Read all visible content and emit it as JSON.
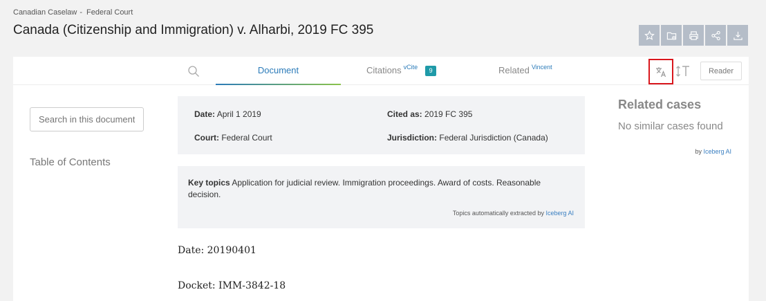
{
  "breadcrumb": {
    "root": "Canadian Caselaw",
    "separator": "-",
    "current": "Federal Court"
  },
  "title": "Canada (Citizenship and Immigration) v. Alharbi, 2019 FC 395",
  "actions": [
    "star-icon",
    "folder-add-icon",
    "print-icon",
    "share-icon",
    "download-icon"
  ],
  "tabs": {
    "document": "Document",
    "citations": "Citations",
    "citations_sup": "vCite",
    "citations_count": "9",
    "related": "Related",
    "related_sup": "Vincent"
  },
  "reader_label": "Reader",
  "search": {
    "placeholder": "Search in this document"
  },
  "toc_label": "Table of Contents",
  "meta": {
    "date_label": "Date:",
    "date": "April 1 2019",
    "cited_label": "Cited as:",
    "cited": "2019 FC 395",
    "court_label": "Court:",
    "court": "Federal Court",
    "jurisdiction_label": "Jurisdiction:",
    "jurisdiction": "Federal Jurisdiction (Canada)"
  },
  "topics": {
    "label": "Key topics",
    "text": "Application for judicial review. Immigration proceedings. Award of costs. Reasonable decision.",
    "note": "Topics automatically extracted by",
    "note_link": "Iceberg AI"
  },
  "document_lines": [
    "Date: 20190401",
    "Docket: IMM-3842-18"
  ],
  "related": {
    "title": "Related cases",
    "empty": "No similar cases found",
    "by": "by",
    "by_link": "Iceberg AI"
  },
  "colors": {
    "accent": "#2b7bb9",
    "badge": "#1f9aa8",
    "highlight": "#d9161c",
    "action_bg": "#b5bdc8"
  }
}
